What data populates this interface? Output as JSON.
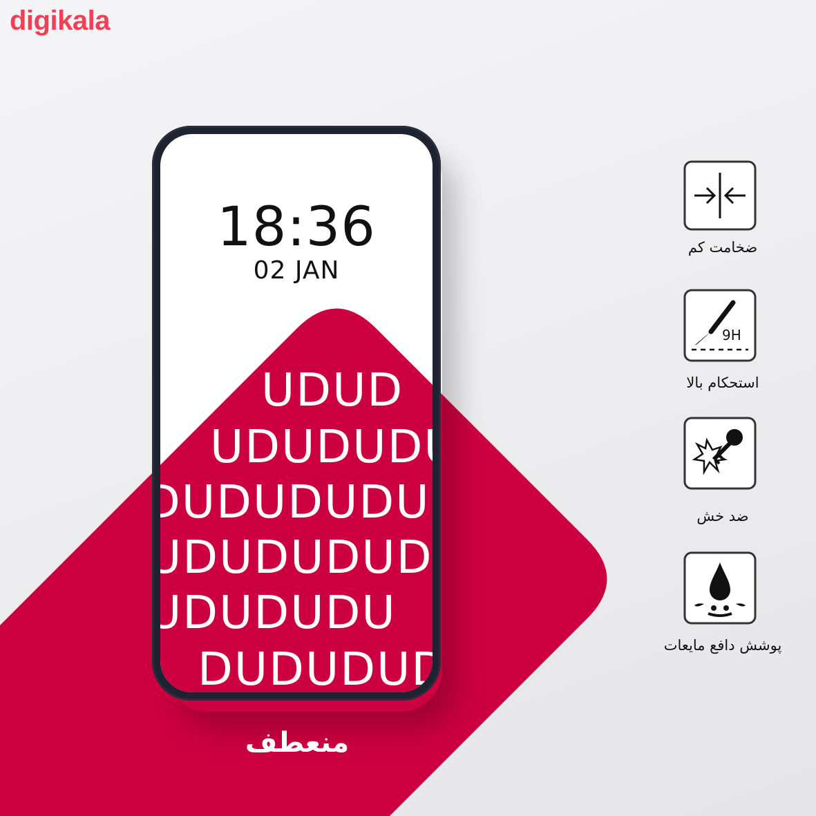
{
  "brand": {
    "logo_text": "digikala",
    "accent_color": "#ef4056",
    "shape_color": "#cc0040"
  },
  "phone": {
    "time": "18:36",
    "date": "02 JAN",
    "pattern_lines": [
      "UDUD",
      "UDUDUDU",
      "DUDUDUDUD",
      "UDUDUDUD",
      "UDUDUDU",
      "DUDUDUD"
    ]
  },
  "features": [
    {
      "icon": "thin-thickness-arrows-icon",
      "label": "ضخامت کم"
    },
    {
      "icon": "hardness-9h-scalpel-icon",
      "label": "استحکام بالا"
    },
    {
      "icon": "scratch-resistant-key-icon",
      "label": "ضد خش"
    },
    {
      "icon": "water-drop-repellent-icon",
      "label": "پوشش دافع مایعات"
    }
  ],
  "bottom_label": "منعطف"
}
